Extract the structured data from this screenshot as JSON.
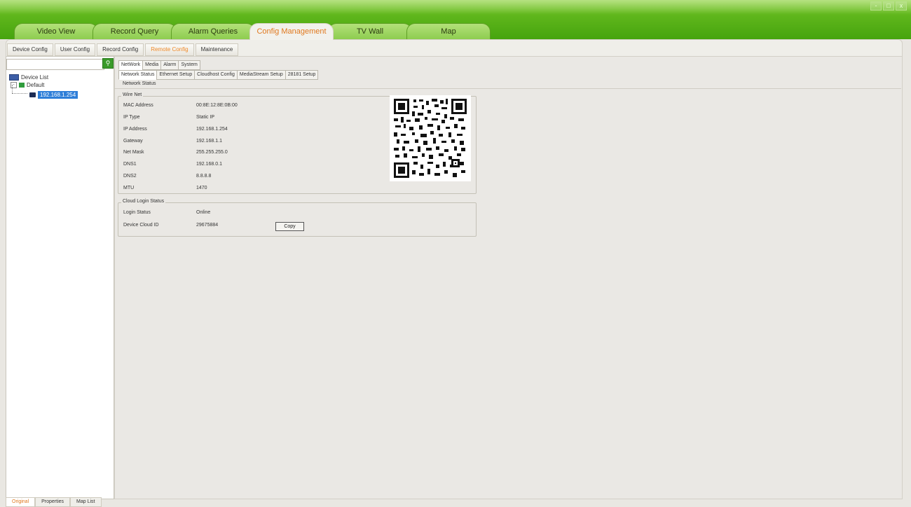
{
  "window_controls": [
    "-",
    "□",
    "x"
  ],
  "main_tabs": [
    {
      "label": "Video View"
    },
    {
      "label": "Record Query"
    },
    {
      "label": "Alarm Queries"
    },
    {
      "label": "Config Management",
      "active": true
    },
    {
      "label": "TV Wall"
    },
    {
      "label": "Map"
    }
  ],
  "sub_tabs": [
    {
      "label": "Device Config"
    },
    {
      "label": "User Config"
    },
    {
      "label": "Record Config"
    },
    {
      "label": "Remote Config",
      "active": true
    },
    {
      "label": "Maintenance"
    }
  ],
  "search": {
    "placeholder": ""
  },
  "tree": {
    "root": "Device List",
    "group": "Default",
    "device": "192.168.1.254"
  },
  "bottom_tabs": [
    {
      "label": "Original",
      "active": true
    },
    {
      "label": "Properties"
    },
    {
      "label": "Map List"
    }
  ],
  "config_tabs": [
    {
      "label": "NetWork",
      "active": true
    },
    {
      "label": "Media"
    },
    {
      "label": "Alarm"
    },
    {
      "label": "System"
    }
  ],
  "network_tabs": [
    {
      "label": "Network Status",
      "active": true
    },
    {
      "label": "Ethernet Setup"
    },
    {
      "label": "Cloudhost Config"
    },
    {
      "label": "MediaStream Setup"
    },
    {
      "label": "28181 Setup"
    }
  ],
  "page_title": "Network Status",
  "wire_net": {
    "title": "Wire Net",
    "rows": [
      {
        "label": "MAC Address",
        "value": "00:8E:12:8E:0B:00"
      },
      {
        "label": "IP Type",
        "value": "Static IP"
      },
      {
        "label": "IP Address",
        "value": "192.168.1.254"
      },
      {
        "label": "Gateway",
        "value": "192.168.1.1"
      },
      {
        "label": "Net Mask",
        "value": "255.255.255.0"
      },
      {
        "label": "DNS1",
        "value": "192.168.0.1"
      },
      {
        "label": "DNS2",
        "value": "8.8.8.8"
      },
      {
        "label": "MTU",
        "value": "1470"
      }
    ]
  },
  "cloud": {
    "title": "Cloud Login Status",
    "login_status_label": "Login Status",
    "login_status_value": "Online",
    "cloud_id_label": "Device Cloud ID",
    "cloud_id_value": "29675884",
    "copy_label": "Copy"
  },
  "colors": {
    "accent_green": "#5fb61c",
    "active_tab_text": "#e0781e",
    "selection": "#2e7ed8"
  }
}
